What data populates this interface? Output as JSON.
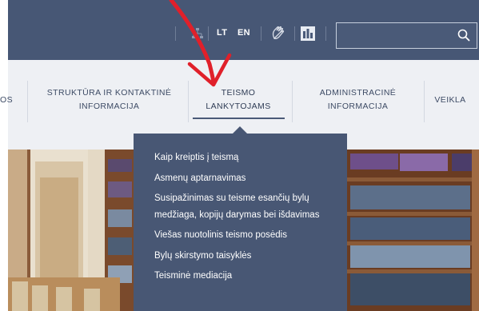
{
  "header": {
    "languages": [
      "LT",
      "EN"
    ],
    "search": {
      "placeholder": "",
      "value": ""
    },
    "icons": [
      "sitemap-icon",
      "sign-language-icon",
      "accessibility-icon",
      "search-icon"
    ]
  },
  "nav": {
    "items": [
      {
        "label": "OS"
      },
      {
        "label": "STRUKTŪRA IR KONTAKTINĖ INFORMACIJA"
      },
      {
        "label": "TEISMO LANKYTOJAMS"
      },
      {
        "label": "ADMINISTRACINĖ INFORMACIJA"
      },
      {
        "label": "VEIKLA"
      }
    ],
    "active_index": 2
  },
  "dropdown": {
    "items": [
      "Kaip kreiptis į teismą",
      "Asmenų aptarnavimas",
      "Susipažinimas su teisme esančių bylų medžiaga, kopijų darymas bei išdavimas",
      "Viešas nuotolinis teismo posėdis",
      "Bylų skirstymo taisyklės",
      "Teisminė mediacija"
    ]
  },
  "colors": {
    "header_bg": "#475775",
    "nav_bg": "#eef0f4",
    "dropdown_bg": "#485774",
    "annotation_arrow": "#e0202a"
  }
}
